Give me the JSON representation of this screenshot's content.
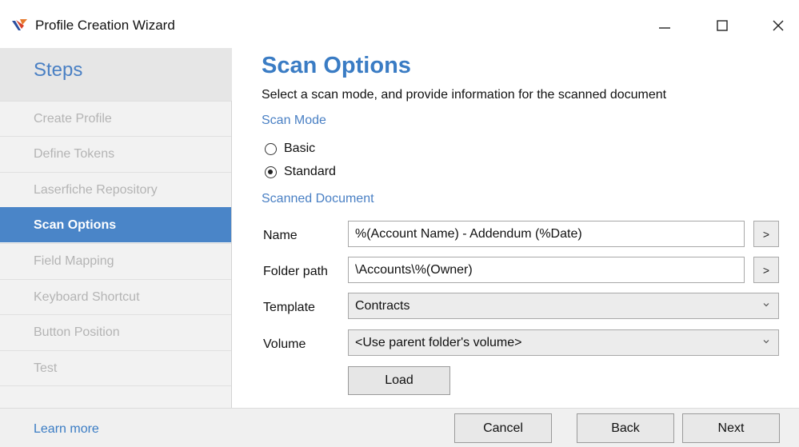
{
  "window": {
    "title": "Profile Creation Wizard",
    "minimize_glyph": "—",
    "maximize_icon": "square-outline-icon",
    "close_glyph": "✕"
  },
  "sidebar": {
    "header": "Steps",
    "items": [
      {
        "label": "Create Profile",
        "active": false
      },
      {
        "label": "Define Tokens",
        "active": false
      },
      {
        "label": "Laserfiche Repository",
        "active": false
      },
      {
        "label": "Scan Options",
        "active": true
      },
      {
        "label": "Field Mapping",
        "active": false
      },
      {
        "label": "Keyboard Shortcut",
        "active": false
      },
      {
        "label": "Button Position",
        "active": false
      },
      {
        "label": "Test",
        "active": false
      }
    ]
  },
  "main": {
    "title": "Scan Options",
    "subtitle": "Select a scan mode, and provide information for the scanned document",
    "scan_mode": {
      "label": "Scan Mode",
      "options": [
        {
          "label": "Basic",
          "checked": false
        },
        {
          "label": "Standard",
          "checked": true
        }
      ]
    },
    "scanned_document": {
      "label": "Scanned Document",
      "name": {
        "label": "Name",
        "value": "%(Account Name) - Addendum (%Date)",
        "browse": ">"
      },
      "folder_path": {
        "label": "Folder path",
        "value": "\\Accounts\\%(Owner)",
        "browse": ">"
      },
      "template": {
        "label": "Template",
        "value": "Contracts"
      },
      "volume": {
        "label": "Volume",
        "value": "<Use parent folder's volume>"
      },
      "load_label": "Load"
    }
  },
  "footer": {
    "learn_more": "Learn more",
    "cancel": "Cancel",
    "back": "Back",
    "next": "Next"
  },
  "colors": {
    "accent": "#3a7cc4",
    "active_step_bg": "#4a85c8",
    "inactive_step_text": "#b4b4b4"
  }
}
